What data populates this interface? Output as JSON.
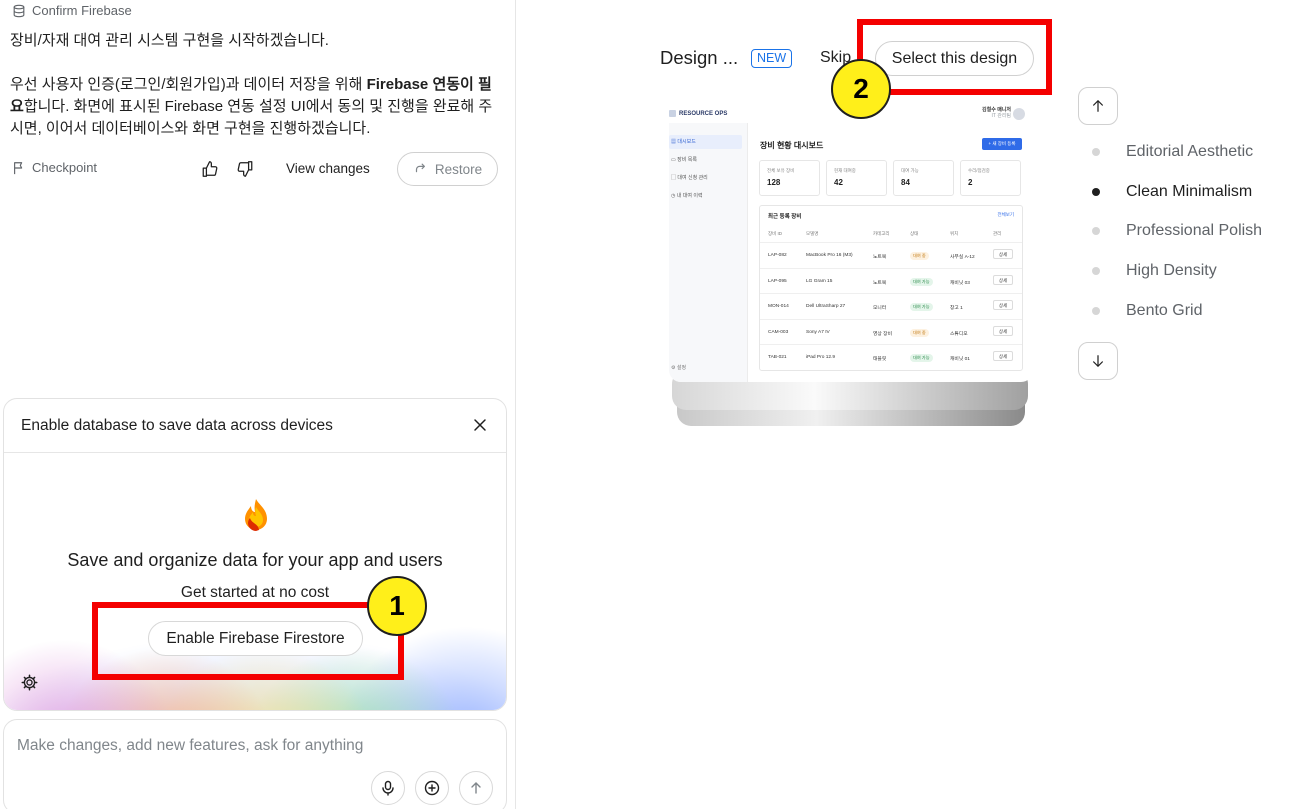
{
  "left": {
    "breadcrumb": "Confirm Firebase",
    "message": {
      "line1": "장비/자재 대여 관리 시스템 구현을 시작하겠습니다.",
      "line2_part1": "우선 사용자 인증(로그인/회원가입)과 데이터 저장을 위해 ",
      "line2_bold": "Firebase 연동이 필요",
      "line2_part2": "합니다. 화면에 표시된 Firebase 연동 설정 UI에서 동의 및 진행을 완료해 주시면, 이어서 데이터베이스와 화면 구현을 진행하겠습니다."
    },
    "actions": {
      "checkpoint": "Checkpoint",
      "view_changes": "View changes",
      "restore": "Restore"
    },
    "firebase_card": {
      "title": "Enable database to save data across devices",
      "heading": "Save and organize data for your app and users",
      "subheading": "Get started at no cost",
      "button": "Enable Firebase Firestore"
    },
    "chat": {
      "placeholder": "Make changes, add new features, ask for anything"
    }
  },
  "right": {
    "design_title": "Design ...",
    "badge": "NEW",
    "skip": "Skip",
    "select": "Select this design",
    "styles": [
      {
        "label": "Editorial Aesthetic",
        "selected": false
      },
      {
        "label": "Clean Minimalism",
        "selected": true
      },
      {
        "label": "Professional Polish",
        "selected": false
      },
      {
        "label": "High Density",
        "selected": false
      },
      {
        "label": "Bento Grid",
        "selected": false
      }
    ],
    "preview": {
      "logo": "RESOURCE OPS",
      "user_name": "김철수 매니저",
      "user_role": "IT 관리팀",
      "nav": [
        "대시보드",
        "장비 목록",
        "대여 신청 관리",
        "내 대여 이력"
      ],
      "settings": "설정",
      "heading": "장비 현황 대시보드",
      "new_button": "+ 새 장비 등록",
      "stats": [
        {
          "label": "전체 보유 장비",
          "value": "128"
        },
        {
          "label": "현재 대여중",
          "value": "42"
        },
        {
          "label": "대여 가능",
          "value": "84"
        },
        {
          "label": "수리/점검중",
          "value": "2"
        }
      ],
      "table_title": "최근 등록 장비",
      "view_all": "전체보기",
      "columns": [
        "장비 ID",
        "모델명",
        "카테고리",
        "상태",
        "위치",
        "관리"
      ],
      "rows": [
        {
          "id": "LAP-082",
          "model": "MacBook Pro 16 (M3)",
          "cat": "노트북",
          "status": "대여 중",
          "busy": true,
          "loc": "사무실 A-12",
          "action": "상세"
        },
        {
          "id": "LAP-095",
          "model": "LG Gram 15",
          "cat": "노트북",
          "status": "대여 가능",
          "busy": false,
          "loc": "캐비닛 03",
          "action": "상세"
        },
        {
          "id": "MON-014",
          "model": "Dell UltraSharp 27",
          "cat": "모니터",
          "status": "대여 가능",
          "busy": false,
          "loc": "창고 1",
          "action": "상세"
        },
        {
          "id": "CAM-003",
          "model": "Sony A7 IV",
          "cat": "영상 장비",
          "status": "대여 중",
          "busy": true,
          "loc": "스튜디오",
          "action": "상세"
        },
        {
          "id": "TAB-021",
          "model": "iPad Pro 12.9",
          "cat": "태블릿",
          "status": "대여 가능",
          "busy": false,
          "loc": "캐비닛 01",
          "action": "상세"
        }
      ]
    }
  },
  "annotations": {
    "marker1": "1",
    "marker2": "2"
  },
  "colors": {
    "accent": "#1a73e8",
    "annotation_red": "#f40000",
    "annotation_yellow": "#ffef1a"
  }
}
